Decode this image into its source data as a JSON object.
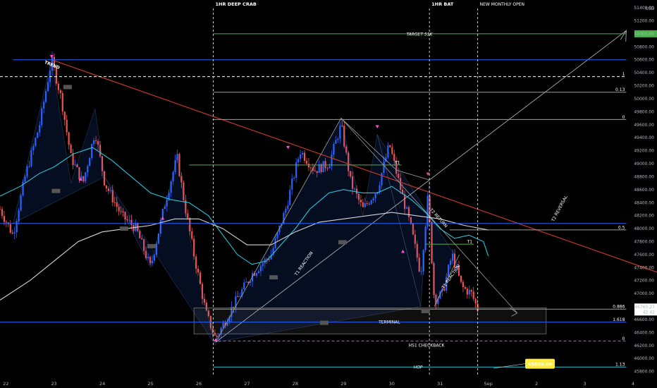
{
  "chart_data": {
    "type": "line",
    "currency_label": "USD",
    "y_tick_labels": [
      "51400.00",
      "51200.00",
      "51000.00",
      "50800.00",
      "50600.00",
      "50400.00",
      "50200.00",
      "50000.00",
      "49800.00",
      "49600.00",
      "49400.00",
      "49200.00",
      "49000.00",
      "48800.00",
      "48600.00",
      "48400.00",
      "48200.00",
      "48000.00",
      "47800.00",
      "47600.00",
      "47400.00",
      "47200.00",
      "47000.00",
      "46800.00",
      "46600.00",
      "46400.00",
      "46200.00",
      "46000.00",
      "45800.00"
    ],
    "ylim": [
      45720,
      51520
    ],
    "x_tick_labels": [
      "22",
      "23",
      "24",
      "25",
      "26",
      "27",
      "28",
      "29",
      "30",
      "31",
      "Sep",
      "2",
      "3",
      "4"
    ],
    "x_ticks": [
      0,
      1,
      2,
      3,
      4,
      5,
      6,
      7,
      8,
      9,
      10,
      11,
      12,
      13
    ],
    "xlim": [
      -0.12,
      13.0
    ],
    "last_price": "46765.27",
    "countdown": "42:42",
    "series": [
      {
        "color": "#26c6da",
        "values": [
          [
            -0.12,
            48500
          ],
          [
            0.3,
            48650
          ],
          [
            0.7,
            48850
          ],
          [
            1.0,
            48950
          ],
          [
            1.4,
            49150
          ],
          [
            1.8,
            49250
          ],
          [
            2.2,
            49050
          ],
          [
            2.6,
            48800
          ],
          [
            3.0,
            48550
          ],
          [
            3.4,
            48450
          ],
          [
            3.8,
            48400
          ],
          [
            4.2,
            48200
          ],
          [
            4.5,
            47900
          ],
          [
            4.8,
            47600
          ],
          [
            5.1,
            47450
          ],
          [
            5.4,
            47500
          ],
          [
            5.7,
            47750
          ],
          [
            6.0,
            48000
          ],
          [
            6.3,
            48300
          ],
          [
            6.7,
            48550
          ],
          [
            7.0,
            48600
          ],
          [
            7.4,
            48550
          ],
          [
            7.7,
            48550
          ],
          [
            8.0,
            48650
          ],
          [
            8.4,
            48450
          ],
          [
            8.7,
            48250
          ],
          [
            9.0,
            48000
          ],
          [
            9.3,
            47850
          ],
          [
            9.6,
            47900
          ],
          [
            9.9,
            47800
          ],
          [
            10.0,
            47580
          ]
        ]
      },
      {
        "color": "#d6d6d6",
        "values": [
          [
            -0.12,
            46900
          ],
          [
            0.5,
            47200
          ],
          [
            1.0,
            47500
          ],
          [
            1.5,
            47800
          ],
          [
            2.0,
            47950
          ],
          [
            2.5,
            48000
          ],
          [
            3.0,
            48050
          ],
          [
            3.5,
            48150
          ],
          [
            4.0,
            48150
          ],
          [
            4.5,
            48000
          ],
          [
            5.0,
            47750
          ],
          [
            5.5,
            47750
          ],
          [
            6.0,
            47950
          ],
          [
            6.5,
            48100
          ],
          [
            7.0,
            48150
          ],
          [
            7.5,
            48200
          ],
          [
            8.0,
            48250
          ],
          [
            8.5,
            48200
          ],
          [
            9.0,
            48150
          ],
          [
            9.5,
            48050
          ],
          [
            10.0,
            47980
          ]
        ]
      }
    ],
    "horizontal_levels": [
      {
        "value": 51000,
        "color": "#4caf50",
        "label": "TARGET 51K",
        "badge": "51000.00",
        "x0": 4.3,
        "x1": 12.86
      },
      {
        "value": 50600,
        "color": "#2962ff",
        "x0": 0.15,
        "x1": 12.86
      },
      {
        "value": 50340,
        "color": "#ffffff",
        "dashed": true,
        "x0": -0.12,
        "x1": 12.86,
        "tag": "1"
      },
      {
        "value": 50100,
        "color": "#9e9e9e",
        "x0": 4.3,
        "x1": 12.86,
        "tag": "0.13"
      },
      {
        "value": 49680,
        "color": "#9e9e9e",
        "x0": 4.3,
        "x1": 12.86,
        "tag": "0"
      },
      {
        "value": 48980,
        "color": "#4caf50",
        "x0": 3.8,
        "x1": 8.2,
        "tag": "T1"
      },
      {
        "value": 48080,
        "color": "#2962ff",
        "x0": -0.12,
        "x1": 12.86
      },
      {
        "value": 47980,
        "color": "#9e9e9e",
        "x0": 9.2,
        "x1": 12.86,
        "tag": "0.5"
      },
      {
        "value": 47760,
        "color": "#4caf50",
        "x0": 8.7,
        "x1": 9.7,
        "tag": "T1"
      },
      {
        "value": 46760,
        "color": "#9e9e9e",
        "x0": 4.3,
        "x1": 12.86,
        "tag": "0.886"
      },
      {
        "value": 46560,
        "color": "#2962ff",
        "x0": -0.12,
        "x1": 12.86,
        "tag": "1.618"
      },
      {
        "value": 46270,
        "color": "#e040fb",
        "dashed": true,
        "x0": 4.3,
        "x1": 12.86,
        "label": "HS1 CHECKBACK",
        "tag": "0"
      },
      {
        "value": 45870,
        "color": "#26c6da",
        "label": "HOP",
        "x0": 4.3,
        "x1": 12.86,
        "tag": "1.13"
      }
    ],
    "vertical_markers": [
      {
        "x": 4.3,
        "label": "1HR DEEP CRAB"
      },
      {
        "x": 8.78,
        "label": "1HR BAT"
      },
      {
        "x": 9.78,
        "label": "NEW MONTHLY OPEN"
      }
    ],
    "annotations": [
      {
        "text": "TREND",
        "x": 0.95,
        "y": 50500,
        "color": "#26c6da"
      },
      {
        "text": "T2 REVERSAL",
        "x": 11.5,
        "y": 48300,
        "color": "#ffffff"
      },
      {
        "text": "T2 RETURN",
        "x": 8.95,
        "y": 48150,
        "color": "#ffffff"
      },
      {
        "text": "T1 REACTION",
        "x": 6.2,
        "y": 47450,
        "color": "#ffffff"
      },
      {
        "text": "TERMINAL",
        "x": 7.95,
        "y": 46540,
        "color": "#8b9a3b"
      },
      {
        "text": "T1 REACTION",
        "x": 9.25,
        "y": 47250,
        "color": "#ffffff"
      }
    ],
    "price_callout": "45850.00"
  }
}
